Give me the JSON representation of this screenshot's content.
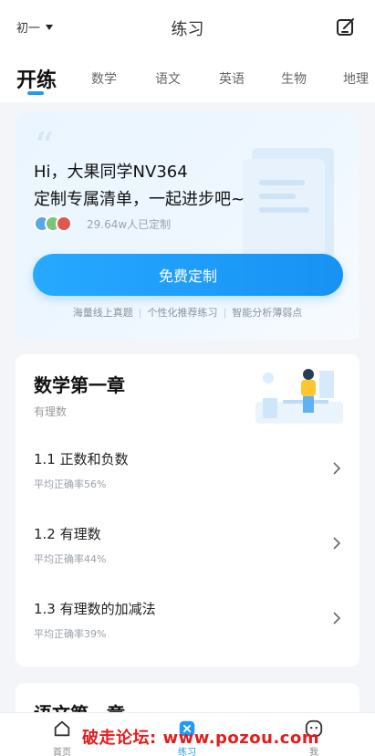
{
  "topbar": {
    "grade": "初一",
    "title": "练习"
  },
  "tabs": [
    {
      "label": "开练"
    },
    {
      "label": "数学"
    },
    {
      "label": "语文"
    },
    {
      "label": "英语"
    },
    {
      "label": "生物"
    },
    {
      "label": "地理"
    }
  ],
  "hero": {
    "greeting": "Hi，大果同学NV364",
    "subtitle": "定制专属清单，一起进步吧~",
    "count": "29.64w人已定制",
    "cta": "免费定制",
    "features": [
      "海量线上真题",
      "个性化推荐练习",
      "智能分析薄弱点"
    ]
  },
  "card1": {
    "chapter": "数学第一章",
    "subtitle": "有理数",
    "lessons": [
      {
        "name": "1.1 正数和负数",
        "accuracy": "平均正确率56%"
      },
      {
        "name": "1.2 有理数",
        "accuracy": "平均正确率44%"
      },
      {
        "name": "1.3 有理数的加减法",
        "accuracy": "平均正确率39%"
      }
    ]
  },
  "card2": {
    "chapter": "语文第一章"
  },
  "bottom_nav": [
    {
      "label": "首页"
    },
    {
      "label": "练习"
    },
    {
      "label": "我"
    }
  ],
  "watermark": "破走论坛: www.pozou.com",
  "colors": {
    "accent": "#1e9bf6",
    "background": "#f3f5f8"
  }
}
